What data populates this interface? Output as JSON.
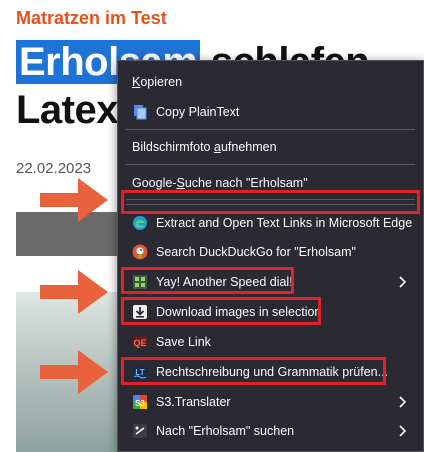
{
  "article": {
    "kicker": "Matratzen im Test",
    "headline_selected": "Erholsam",
    "headline_rest1": " schlafen -",
    "headline_line2": "Latex",
    "date": "22.02.2023"
  },
  "menu": {
    "copy": {
      "access": "K",
      "rest": "opieren"
    },
    "copy_plain": "Copy PlainText",
    "screenshot": {
      "before": "Bildschirmfoto ",
      "access": "a",
      "after": "ufnehmen"
    },
    "google": {
      "before": "Google-",
      "access": "S",
      "after": "uche nach \"Erholsam\""
    },
    "edge_links": "Extract and Open Text Links in Microsoft Edge",
    "duckduckgo": "Search DuckDuckGo for \"Erholsam\"",
    "speed_dial": "Yay! Another Speed dial!",
    "download_images": "Download images in selection",
    "save_link": "Save Link",
    "spellcheck": "Rechtschreibung und Grammatik prüfen...",
    "translater": "S3.Translater",
    "search_in": "Nach \"Erholsam\" suchen"
  },
  "colors": {
    "menu_bg": "#2b2a33",
    "highlight_box": "#e0202a",
    "arrow": "#e8633b",
    "selection": "#1e73d6",
    "kicker": "#e8501d"
  },
  "icons": [
    "page-copy-icon",
    "edge-icon",
    "duckduckgo-icon",
    "speed-dial-icon",
    "download-icon",
    "save-link-icon",
    "spellcheck-icon",
    "translater-icon",
    "search-icon",
    "chevron-right-icon",
    "arrow-pointer-icon"
  ]
}
